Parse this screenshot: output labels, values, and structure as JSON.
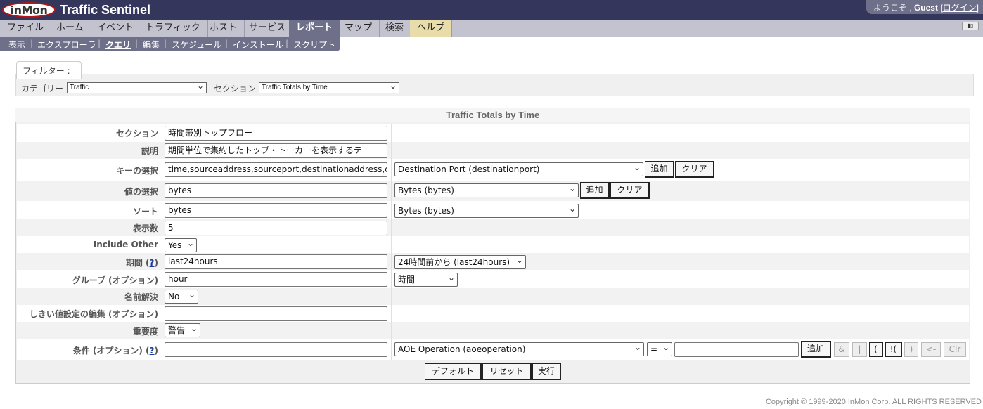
{
  "header": {
    "logo_text": "inMon",
    "app_title": "Traffic Sentinel",
    "welcome_prefix": "ようこそ , ",
    "user": "Guest",
    "login_link": "[ログイン]"
  },
  "tabs": [
    "ファイル",
    "ホーム",
    "イベント",
    "トラフィック",
    "ホスト",
    "サービス",
    "レポート",
    "マップ",
    "検索",
    "ヘルプ"
  ],
  "subtabs": [
    "表示",
    "エクスプローラ",
    "クエリ",
    "編集",
    "スケジュール",
    "インストール",
    "スクリプト"
  ],
  "filter": {
    "legend": "フィルター :",
    "category_label": "カテゴリー",
    "category_value": "Traffic",
    "section_label": "セクション",
    "section_value": "Traffic Totals by Time"
  },
  "panel": {
    "title": "Traffic Totals by Time"
  },
  "form": {
    "section": {
      "label": "セクション",
      "value": "時間帯別トップフロー"
    },
    "description": {
      "label": "説明",
      "value": "期間単位で集約したトップ・トーカーを表示するテ"
    },
    "keys": {
      "label": "キーの選択",
      "value": "time,sourceaddress,sourceport,destinationaddress,d",
      "select": "Destination Port (destinationport)",
      "add": "追加",
      "clear": "クリア"
    },
    "values": {
      "label": "値の選択",
      "value": "bytes",
      "select": "Bytes (bytes)",
      "add": "追加",
      "clear": "クリア"
    },
    "sort": {
      "label": "ソート",
      "value": "bytes",
      "select": "Bytes (bytes)"
    },
    "count": {
      "label": "表示数",
      "value": "5"
    },
    "include_other": {
      "label": "Include Other",
      "select": "Yes"
    },
    "period": {
      "label": "期間 (",
      "help": "?",
      "label_end": ")",
      "value": "last24hours",
      "select": "24時間前から (last24hours)"
    },
    "group": {
      "label": "グループ (オプション)",
      "value": "hour",
      "select": "時間"
    },
    "resolve": {
      "label": "名前解決",
      "select": "No"
    },
    "threshold": {
      "label": "しきい値設定の編集 (オプション)",
      "value": ""
    },
    "severity": {
      "label": "重要度",
      "select": "警告"
    },
    "condition": {
      "label": "条件 (オプション) (",
      "help": "?",
      "label_end": ")",
      "value": "",
      "select": "AOE Operation (aoeoperation)",
      "op": "=",
      "operand": "",
      "add": "追加",
      "ops": [
        "&",
        "|",
        "(",
        "!(",
        ")",
        "<-",
        "Clr"
      ]
    }
  },
  "actions": {
    "default": "デフォルト",
    "reset": "リセット",
    "run": "実行"
  },
  "footer": {
    "copyright": "Copyright © 1999-2020 InMon Corp. ALL RIGHTS RESERVED"
  }
}
